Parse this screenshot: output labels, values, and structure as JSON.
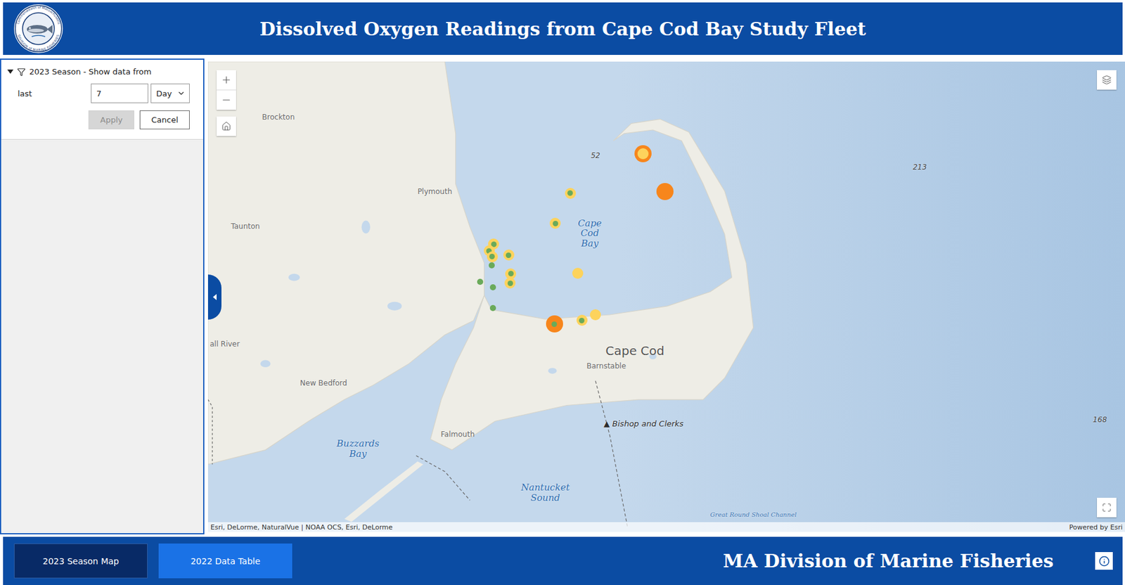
{
  "header": {
    "title": "Dissolved Oxygen Readings from Cape Cod Bay Study Fleet",
    "logo": {
      "top_text": "Commonwealth of Massachusetts",
      "bottom_text": "DIVISION of MARINE FISHERIES"
    }
  },
  "filter": {
    "expanded": true,
    "title": "2023 Season - Show data from",
    "label": "last",
    "value": "7",
    "unit": "Day",
    "buttons": [
      {
        "label": "Apply",
        "disabled": true
      },
      {
        "label": "Cancel",
        "disabled": false
      }
    ]
  },
  "map": {
    "labels": [
      {
        "text": "Brockton",
        "kind": "city"
      },
      {
        "text": "Plymouth",
        "kind": "city"
      },
      {
        "text": "Taunton",
        "kind": "city"
      },
      {
        "text": "all River",
        "kind": "city"
      },
      {
        "text": "New Bedford",
        "kind": "city"
      },
      {
        "text": "Falmouth",
        "kind": "city"
      },
      {
        "text": "Barnstable",
        "kind": "city"
      },
      {
        "text": "Cape Cod",
        "kind": "region"
      },
      {
        "text": "Cape Cod Bay",
        "kind": "water"
      },
      {
        "text": "Buzzards Bay",
        "kind": "water"
      },
      {
        "text": "Nantucket Sound",
        "kind": "water"
      },
      {
        "text": "Great Round Shoal Channel",
        "kind": "channel"
      },
      {
        "text": "52",
        "kind": "depth"
      },
      {
        "text": "213",
        "kind": "depth"
      },
      {
        "text": "168",
        "kind": "depth"
      },
      {
        "text": "Bishop and Clerks",
        "kind": "feature",
        "marker": "▲"
      }
    ],
    "pins": [
      {
        "kind": "large",
        "color": "#f7861c",
        "center": "#fdd35c"
      },
      {
        "kind": "large",
        "color": "#f7861c"
      },
      {
        "kind": "medium",
        "color": "#fdd35c",
        "center": "#6aaa5a"
      },
      {
        "kind": "medium",
        "color": "#fdd35c",
        "center": "#6aaa5a"
      },
      {
        "kind": "medium",
        "color": "#fdd35c",
        "center": "#6aaa5a"
      },
      {
        "kind": "medium",
        "color": "#fdd35c",
        "center": "#6aaa5a"
      },
      {
        "kind": "medium",
        "color": "#fdd35c",
        "center": "#6aaa5a"
      },
      {
        "kind": "medium",
        "color": "#fdd35c",
        "center": "#6aaa5a"
      },
      {
        "kind": "small",
        "color": "#6aaa5a"
      },
      {
        "kind": "medium",
        "color": "#fdd35c",
        "center": "#6aaa5a"
      },
      {
        "kind": "medium",
        "color": "#fdd35c",
        "center": "#6aaa5a"
      },
      {
        "kind": "small",
        "color": "#6aaa5a"
      },
      {
        "kind": "small",
        "color": "#6aaa5a"
      },
      {
        "kind": "medium",
        "color": "#fdd35c"
      },
      {
        "kind": "small",
        "color": "#6aaa5a"
      },
      {
        "kind": "large",
        "color": "#f7861c",
        "center": "#6aaa5a"
      },
      {
        "kind": "medium",
        "color": "#fdd35c",
        "center": "#6aaa5a"
      },
      {
        "kind": "medium",
        "color": "#fdd35c"
      }
    ],
    "attribution": "Esri, DeLorme, NaturalVue | NOAA OCS, Esri, DeLorme",
    "powered_by": "Powered by Esri"
  },
  "footer": {
    "tabs": [
      {
        "label": "2023 Season Map",
        "selected": true
      },
      {
        "label": "2022 Data Table",
        "selected": false
      }
    ],
    "title": "MA Division of Marine Fisheries"
  }
}
